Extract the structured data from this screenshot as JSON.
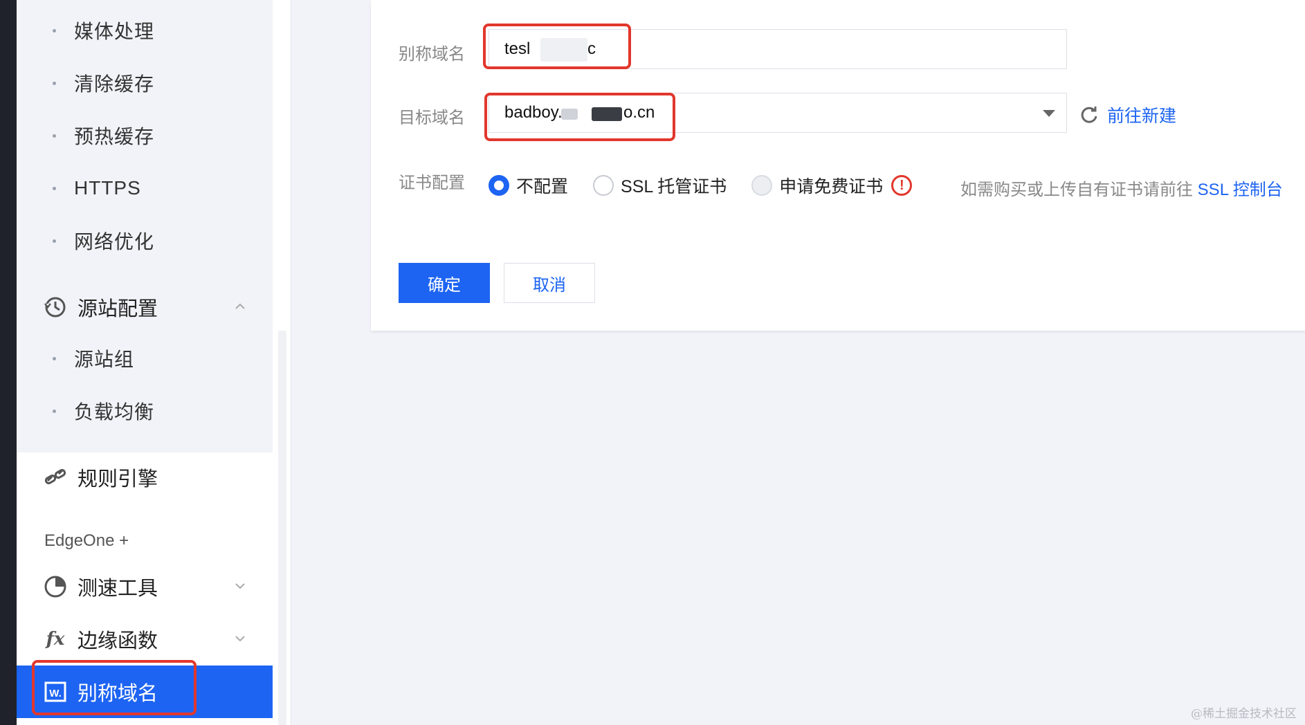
{
  "sidebar": {
    "sub_items_top": [
      "媒体处理",
      "清除缓存",
      "预热缓存",
      "HTTPS",
      "网络优化"
    ],
    "origin_group": {
      "label": "源站配置",
      "icon": "history-icon",
      "expanded": true
    },
    "origin_sub_items": [
      "源站组",
      "负载均衡"
    ],
    "rules_engine": {
      "label": "规则引擎",
      "icon": "link-icon"
    },
    "section_label": "EdgeOne +",
    "speed_test": {
      "label": "测速工具",
      "icon": "pie-chart-icon"
    },
    "edge_functions": {
      "label": "边缘函数",
      "icon": "fx-icon"
    },
    "alias_domain": {
      "label": "别称域名",
      "icon": "domain-badge-icon",
      "active": true
    }
  },
  "form": {
    "alias_label": "别称域名",
    "alias_value_prefix": "tesl",
    "alias_value_suffix": "c",
    "target_label": "目标域名",
    "target_value_prefix": "badboy.",
    "target_value_suffix": "o.cn",
    "create_link": "前往新建",
    "cert_label": "证书配置",
    "cert_options": [
      {
        "label": "不配置",
        "state": "checked"
      },
      {
        "label": "SSL 托管证书",
        "state": "empty"
      },
      {
        "label": "申请免费证书",
        "state": "disabled"
      }
    ],
    "cert_hint": "如需购买或上传自有证书请前往",
    "cert_hint_link": "SSL 控制台",
    "confirm_button": "确定",
    "cancel_button": "取消"
  },
  "colors": {
    "primary": "#1d64f2",
    "highlight": "#e2372c",
    "background": "#f2f3f8"
  },
  "watermark": "@稀土掘金技术社区"
}
